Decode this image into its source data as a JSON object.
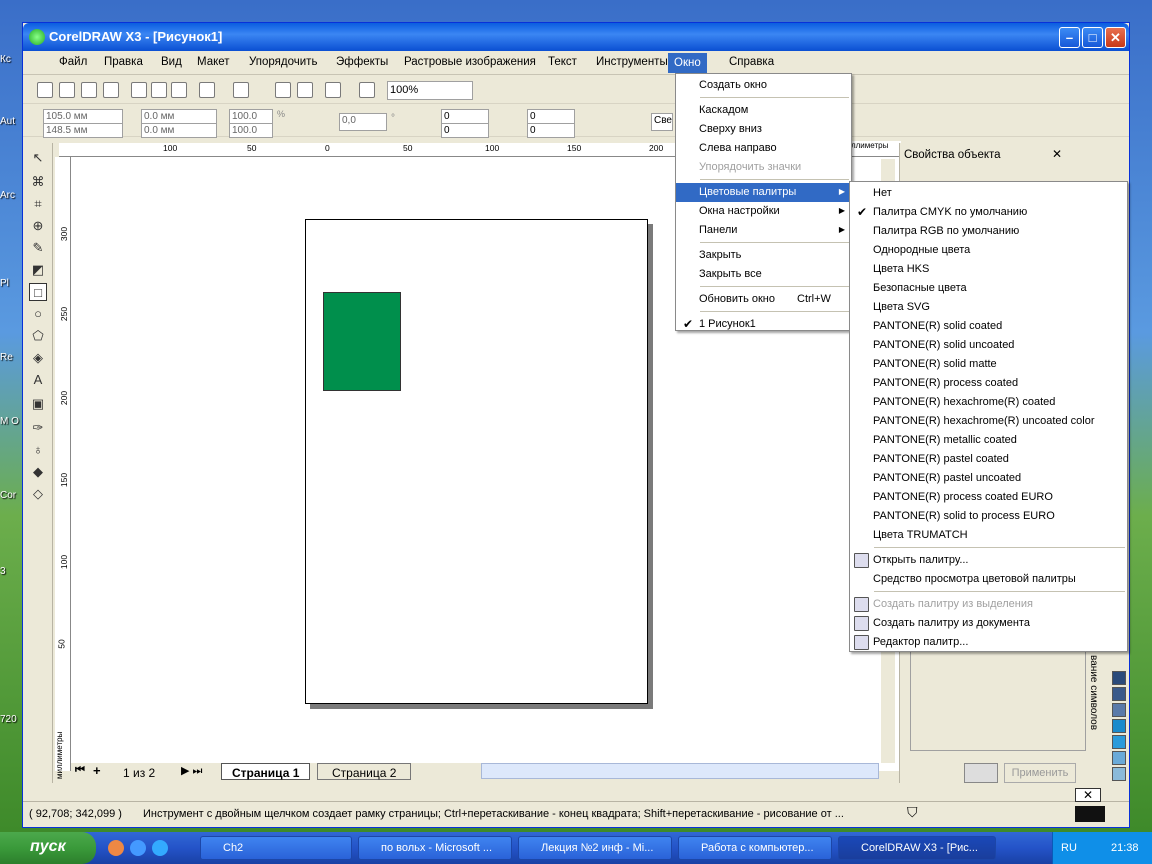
{
  "window": {
    "title": "CorelDRAW X3 - [Рисунок1]",
    "min": "–",
    "max": "□",
    "close": "✕"
  },
  "menubar": [
    "Файл",
    "Правка",
    "Вид",
    "Макет",
    "Упорядочить",
    "Эффекты",
    "Растровые изображения",
    "Текст",
    "Инструменты",
    "Окно",
    "Справка"
  ],
  "toolbar": {
    "zoom": "100%",
    "x": "105.0 мм",
    "y": "148.5 мм",
    "w": "0.0 мм",
    "h": "0.0 мм",
    "sx": "100.0",
    "sy": "100.0",
    "angle": "0,0",
    "pct": "%",
    "deg": "°",
    "n1": "0",
    "n2": "0",
    "n3": "0",
    "n4": "0",
    "fontname": "Све"
  },
  "ruler": {
    "top": [
      "100",
      "50",
      "0",
      "50",
      "100",
      "150",
      "200"
    ],
    "units": "миллиметры",
    "left": [
      "300",
      "250",
      "200",
      "150",
      "100",
      "50"
    ],
    "left_units": "миллиметры"
  },
  "pagetabs": {
    "count": "1 из 2",
    "page1": "Страница 1",
    "page2": "Страница 2"
  },
  "status": {
    "coords": "( 92,708; 342,099 )",
    "hint": "Инструмент с двойным щелчком создает рамку страницы; Ctrl+перетаскивание - конец квадрата; Shift+перетаскивание - рисование от ..."
  },
  "docker": {
    "title": "Свойства объекта",
    "apply": "Применить",
    "vertical_tab": "вание символов"
  },
  "window_menu": {
    "items": [
      {
        "label": "Создать окно",
        "type": "item"
      },
      {
        "type": "sep"
      },
      {
        "label": "Каскадом",
        "type": "item"
      },
      {
        "label": "Сверху вниз",
        "type": "item"
      },
      {
        "label": "Слева направо",
        "type": "item"
      },
      {
        "label": "Упорядочить значки",
        "type": "disabled"
      },
      {
        "type": "sep"
      },
      {
        "label": "Цветовые палитры",
        "type": "sub",
        "highlight": true
      },
      {
        "label": "Окна настройки",
        "type": "sub"
      },
      {
        "label": "Панели",
        "type": "sub"
      },
      {
        "type": "sep"
      },
      {
        "label": "Закрыть",
        "type": "item"
      },
      {
        "label": "Закрыть все",
        "type": "item"
      },
      {
        "type": "sep"
      },
      {
        "label": "Обновить окно",
        "type": "item",
        "shortcut": "Ctrl+W"
      },
      {
        "type": "sep"
      },
      {
        "label": "1 Рисунок1",
        "type": "checked"
      }
    ]
  },
  "palette_menu": {
    "items": [
      {
        "label": "Нет",
        "type": "item"
      },
      {
        "label": "Палитра CMYK по умолчанию",
        "type": "checked"
      },
      {
        "label": "Палитра RGB по умолчанию",
        "type": "item"
      },
      {
        "label": "Однородные цвета",
        "type": "item"
      },
      {
        "label": "Цвета HKS",
        "type": "item"
      },
      {
        "label": "Безопасные цвета",
        "type": "item"
      },
      {
        "label": "Цвета SVG",
        "type": "item"
      },
      {
        "label": "PANTONE(R) solid coated",
        "type": "item"
      },
      {
        "label": "PANTONE(R) solid uncoated",
        "type": "item"
      },
      {
        "label": "PANTONE(R) solid matte",
        "type": "item"
      },
      {
        "label": "PANTONE(R) process coated",
        "type": "item"
      },
      {
        "label": "PANTONE(R) hexachrome(R) coated",
        "type": "item"
      },
      {
        "label": "PANTONE(R) hexachrome(R) uncoated color",
        "type": "item"
      },
      {
        "label": "PANTONE(R) metallic coated",
        "type": "item"
      },
      {
        "label": "PANTONE(R) pastel coated",
        "type": "item"
      },
      {
        "label": "PANTONE(R) pastel uncoated",
        "type": "item"
      },
      {
        "label": "PANTONE(R) process coated EURO",
        "type": "item"
      },
      {
        "label": "PANTONE(R) solid to process EURO",
        "type": "item"
      },
      {
        "label": "Цвета TRUMATCH",
        "type": "item"
      },
      {
        "type": "sep"
      },
      {
        "label": "Открыть палитру...",
        "type": "icon"
      },
      {
        "label": "Средство просмотра цветовой палитры",
        "type": "item"
      },
      {
        "type": "sep"
      },
      {
        "label": "Создать палитру из выделения",
        "type": "disabled_icon"
      },
      {
        "label": "Создать палитру из документа",
        "type": "icon"
      },
      {
        "label": "Редактор палитр...",
        "type": "icon"
      }
    ]
  },
  "desktop_labels": [
    "Кс",
    "Aut",
    "Arc",
    "Pl",
    "Re",
    "M O",
    "Cor",
    "3",
    "720"
  ],
  "taskbar": {
    "start": "пуск",
    "tasks": [
      "Ch2",
      "по вольх - Microsoft ...",
      "Лекция №2 инф - Mi...",
      "Работа с компьютер...",
      "CorelDRAW X3 - [Рис..."
    ],
    "lang": "RU",
    "clock": "21:38"
  },
  "colors": {
    "accent": "#316ac5",
    "shape": "#008f4c"
  }
}
